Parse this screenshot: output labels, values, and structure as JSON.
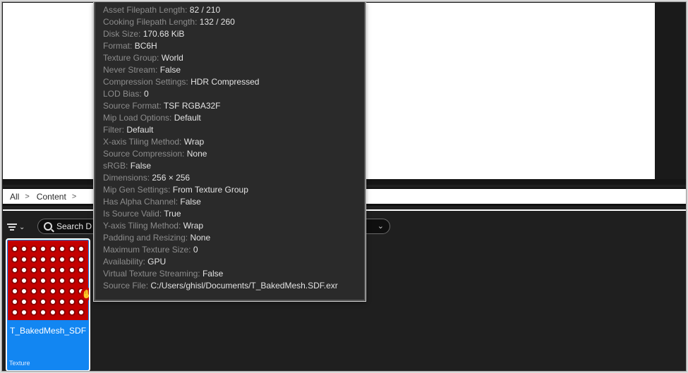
{
  "breadcrumb": {
    "items": [
      "All",
      "Content"
    ]
  },
  "toolbar": {
    "search_placeholder": "Search D"
  },
  "asset": {
    "name": "T_BakedMesh_SDF",
    "type": "Texture"
  },
  "tooltip": {
    "rows": [
      {
        "key": "Asset Filepath Length:",
        "value": "82 / 210"
      },
      {
        "key": "Cooking Filepath Length:",
        "value": "132 / 260"
      },
      {
        "key": "Disk Size:",
        "value": "170.68 KiB"
      },
      {
        "key": "Format:",
        "value": "BC6H"
      },
      {
        "key": "Texture Group:",
        "value": "World"
      },
      {
        "key": "Never Stream:",
        "value": "False"
      },
      {
        "key": "Compression Settings:",
        "value": "HDR Compressed"
      },
      {
        "key": "LOD Bias:",
        "value": "0"
      },
      {
        "key": "Source Format:",
        "value": "TSF RGBA32F"
      },
      {
        "key": "Mip Load Options:",
        "value": "Default"
      },
      {
        "key": "Filter:",
        "value": "Default"
      },
      {
        "key": "X-axis Tiling Method:",
        "value": "Wrap"
      },
      {
        "key": "Source Compression:",
        "value": "None"
      },
      {
        "key": "sRGB:",
        "value": "False"
      },
      {
        "key": "Dimensions:",
        "value": "256 × 256"
      },
      {
        "key": "Mip Gen Settings:",
        "value": "From Texture Group"
      },
      {
        "key": "Has Alpha Channel:",
        "value": "False"
      },
      {
        "key": "Is Source Valid:",
        "value": "True"
      },
      {
        "key": "Y-axis Tiling Method:",
        "value": "Wrap"
      },
      {
        "key": "Padding and Resizing:",
        "value": "None"
      },
      {
        "key": "Maximum Texture Size:",
        "value": "0"
      },
      {
        "key": "Availability:",
        "value": "GPU"
      },
      {
        "key": "Virtual Texture Streaming:",
        "value": "False"
      },
      {
        "key": "Source File:",
        "value": "C:/Users/ghisl/Documents/T_BakedMesh.SDF.exr"
      }
    ]
  },
  "icons": {
    "filter": "filter-icon",
    "dropdown": "chevron-down-icon",
    "search": "search-icon",
    "breadcrumb_separator": "chevron-right-icon",
    "drag_cursor": "hand-grab-icon"
  },
  "colors": {
    "selection": "#1286f2",
    "thumbnail": "#c40000",
    "panel": "#1f1f1f"
  }
}
